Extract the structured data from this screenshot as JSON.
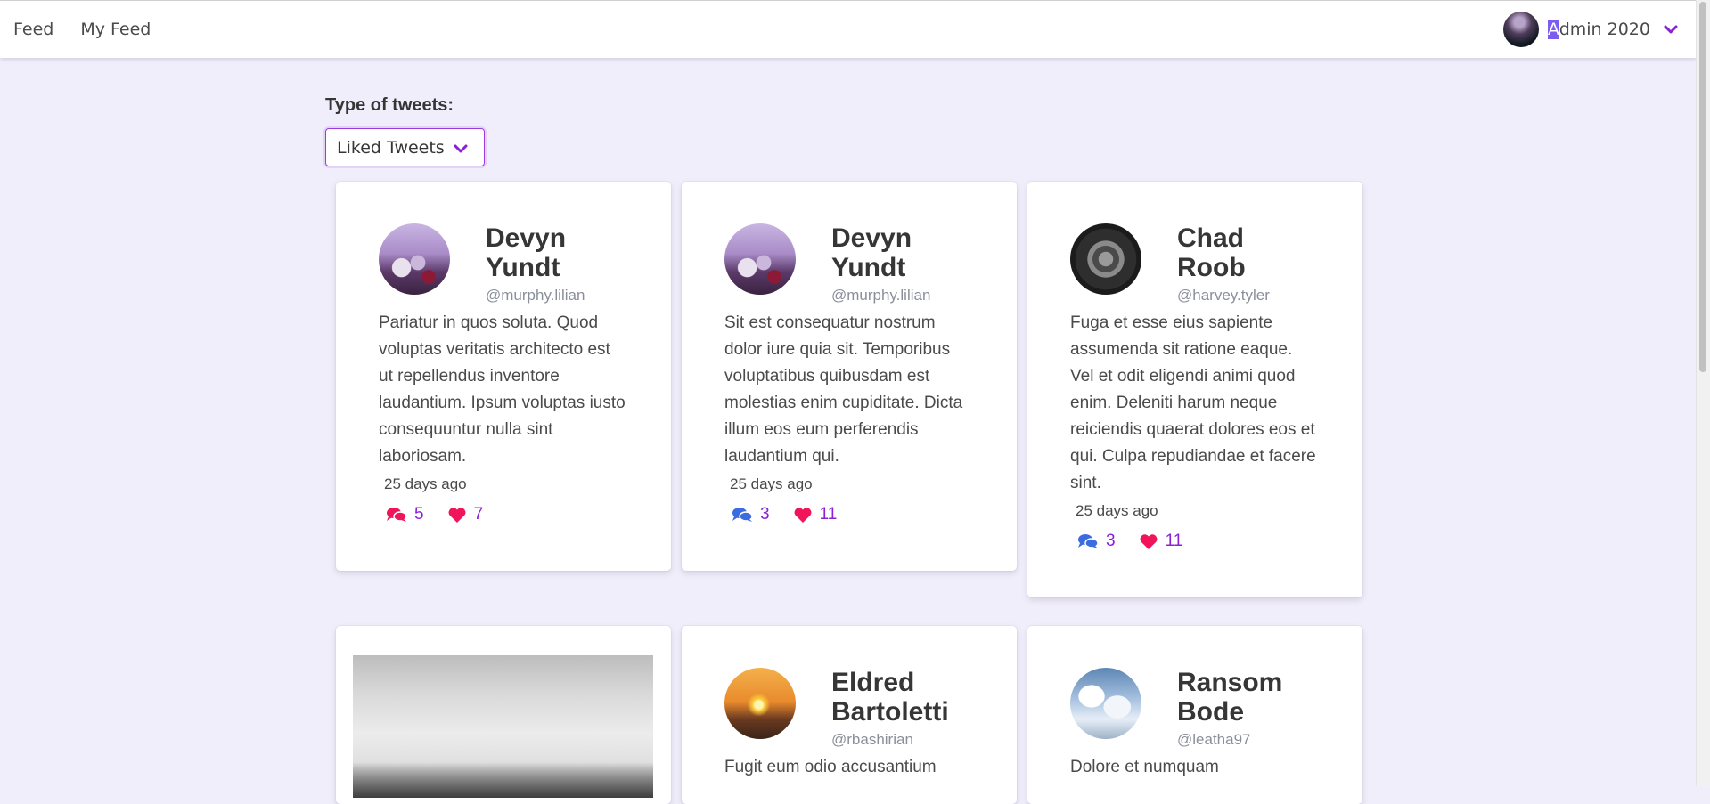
{
  "nav": {
    "feed": "Feed",
    "my_feed": "My Feed"
  },
  "user": {
    "name_first": "A",
    "name_rest": "dmin 2020"
  },
  "filter": {
    "label": "Type of tweets:",
    "selected": "Liked Tweets"
  },
  "colors": {
    "accent": "#8a20d6",
    "comment_active": "#f0145a",
    "comment": "#3a6be0",
    "heart": "#f0145a",
    "background": "#f1eefc"
  },
  "tweets": [
    {
      "name": "Devyn Yundt",
      "handle": "@murphy.lilian",
      "text": "Pariatur in quos soluta. Quod voluptas veritatis architecto est ut repellendus inventore laudantium. Ipsum voluptas iusto consequuntur nulla sint laboriosam.",
      "time": "25 days ago",
      "comments": "5",
      "likes": "7",
      "avatar": "flowers-avatar"
    },
    {
      "name": "Devyn Yundt",
      "handle": "@murphy.lilian",
      "text": "Sit est consequatur nostrum dolor iure quia sit. Temporibus voluptatibus quibusdam est molestias enim cupiditate. Dicta illum eos eum perferendis laudantium qui.",
      "time": "25 days ago",
      "comments": "3",
      "likes": "11",
      "avatar": "flowers-avatar"
    },
    {
      "name": "Chad Roob",
      "handle": "@harvey.tyler",
      "text": "Fuga et esse eius sapiente assumenda sit ratione eaque. Vel et odit eligendi animi quod enim. Deleniti harum neque reiciendis quaerat dolores eos et qui. Culpa repudiandae et facere sint.",
      "time": "25 days ago",
      "comments": "3",
      "likes": "11",
      "avatar": "geometric-avatar"
    },
    {
      "name": "Eldred Bartoletti",
      "handle": "@rbashirian",
      "text": "Fugit eum odio accusantium",
      "avatar": "heart-sunset-avatar"
    },
    {
      "name": "Ransom Bode",
      "handle": "@leatha97",
      "text": "Dolore et numquam",
      "avatar": "clouds-avatar"
    }
  ],
  "icons": {
    "comment": "comments-icon",
    "like": "heart-icon",
    "dropdown": "chevron-down-icon",
    "image": "foggy-forest-image"
  }
}
